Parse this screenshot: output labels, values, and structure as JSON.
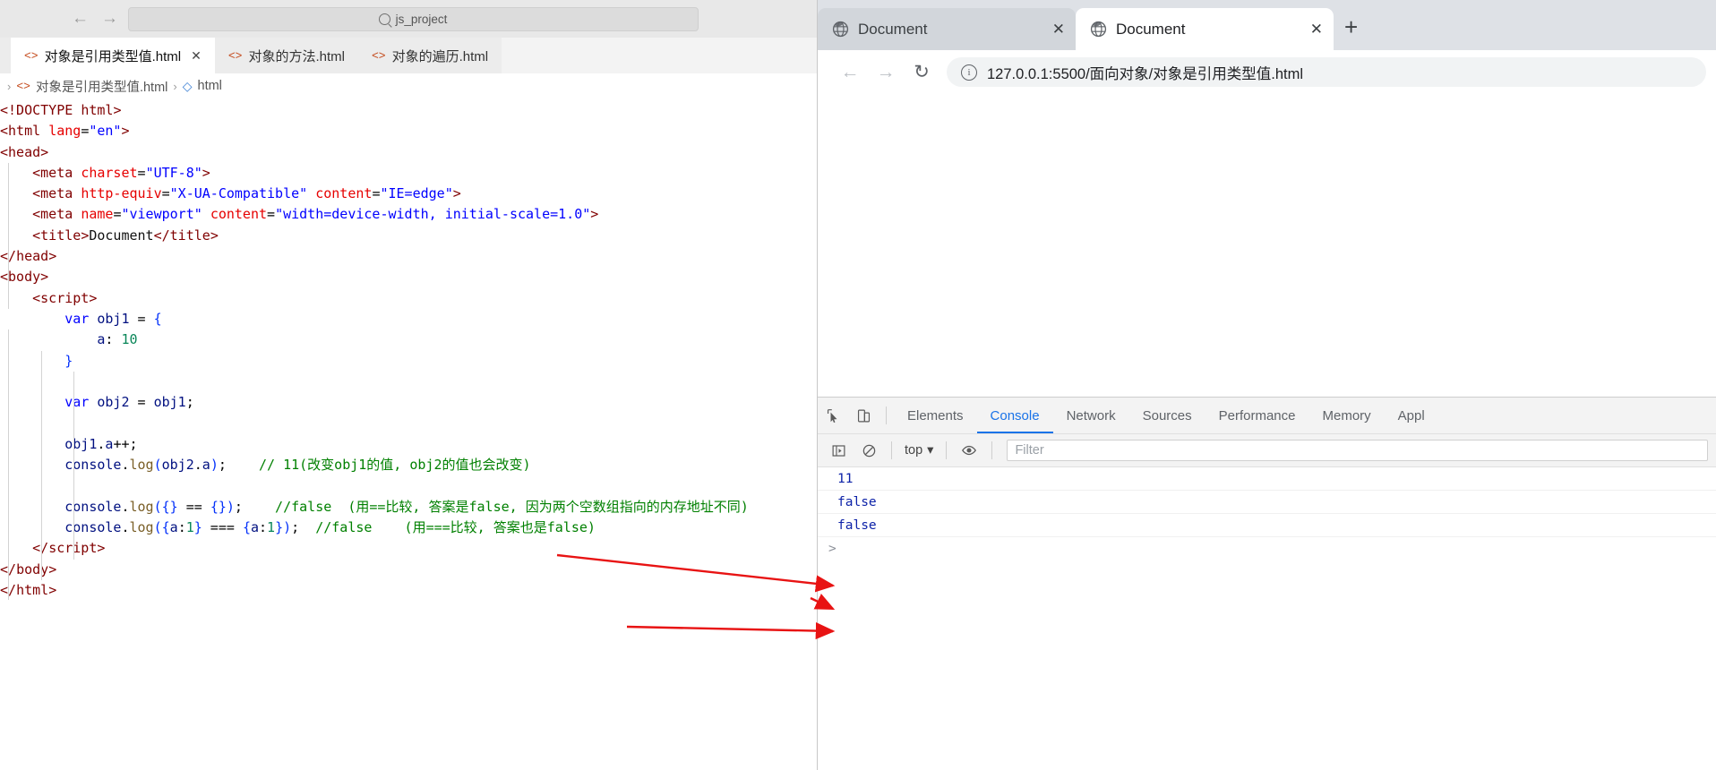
{
  "editor": {
    "quick_input_placeholder": "js_project",
    "nav_back_icon": "arrow-left-icon",
    "nav_forward_icon": "arrow-right-icon",
    "tabs": [
      {
        "label": "对象是引用类型值.html",
        "active": true,
        "close": "✕"
      },
      {
        "label": "对象的方法.html",
        "active": false,
        "close": ""
      },
      {
        "label": "对象的遍历.html",
        "active": false,
        "close": ""
      }
    ],
    "breadcrumb": {
      "lead_sep": "›",
      "file": "对象是引用类型值.html",
      "sep": "›",
      "symbol": "html"
    },
    "code_lines": [
      [
        [
          "tagbr",
          "<!DOCTYPE "
        ],
        [
          "tag",
          "html"
        ],
        [
          "tagbr",
          ">"
        ]
      ],
      [
        [
          "tagbr",
          "<"
        ],
        [
          "tag",
          "html"
        ],
        [
          "txt",
          " "
        ],
        [
          "attr",
          "lang"
        ],
        [
          "punct",
          "="
        ],
        [
          "val",
          "\"en\""
        ],
        [
          "tagbr",
          ">"
        ]
      ],
      [
        [
          "tagbr",
          "<"
        ],
        [
          "tag",
          "head"
        ],
        [
          "tagbr",
          ">"
        ]
      ],
      [
        [
          "txt",
          "    "
        ],
        [
          "tagbr",
          "<"
        ],
        [
          "tag",
          "meta"
        ],
        [
          "txt",
          " "
        ],
        [
          "attr",
          "charset"
        ],
        [
          "punct",
          "="
        ],
        [
          "val",
          "\"UTF-8\""
        ],
        [
          "tagbr",
          ">"
        ]
      ],
      [
        [
          "txt",
          "    "
        ],
        [
          "tagbr",
          "<"
        ],
        [
          "tag",
          "meta"
        ],
        [
          "txt",
          " "
        ],
        [
          "attr",
          "http-equiv"
        ],
        [
          "punct",
          "="
        ],
        [
          "val",
          "\"X-UA-Compatible\""
        ],
        [
          "txt",
          " "
        ],
        [
          "attr",
          "content"
        ],
        [
          "punct",
          "="
        ],
        [
          "val",
          "\"IE=edge\""
        ],
        [
          "tagbr",
          ">"
        ]
      ],
      [
        [
          "txt",
          "    "
        ],
        [
          "tagbr",
          "<"
        ],
        [
          "tag",
          "meta"
        ],
        [
          "txt",
          " "
        ],
        [
          "attr",
          "name"
        ],
        [
          "punct",
          "="
        ],
        [
          "val",
          "\"viewport\""
        ],
        [
          "txt",
          " "
        ],
        [
          "attr",
          "content"
        ],
        [
          "punct",
          "="
        ],
        [
          "val",
          "\"width=device-width, initial-scale=1.0\""
        ],
        [
          "tagbr",
          ">"
        ]
      ],
      [
        [
          "txt",
          "    "
        ],
        [
          "tagbr",
          "<"
        ],
        [
          "tag",
          "title"
        ],
        [
          "tagbr",
          ">"
        ],
        [
          "txt",
          "Document"
        ],
        [
          "tagbr",
          "</"
        ],
        [
          "tag",
          "title"
        ],
        [
          "tagbr",
          ">"
        ]
      ],
      [
        [
          "tagbr",
          "</"
        ],
        [
          "tag",
          "head"
        ],
        [
          "tagbr",
          ">"
        ]
      ],
      [
        [
          "tagbr",
          "<"
        ],
        [
          "tag",
          "body"
        ],
        [
          "tagbr",
          ">"
        ]
      ],
      [
        [
          "txt",
          "    "
        ],
        [
          "tagbr",
          "<"
        ],
        [
          "tag",
          "script"
        ],
        [
          "tagbr",
          ">"
        ]
      ],
      [
        [
          "txt",
          "        "
        ],
        [
          "kw",
          "var"
        ],
        [
          "txt",
          " "
        ],
        [
          "id",
          "obj1"
        ],
        [
          "punct",
          " = "
        ],
        [
          "brace-b",
          "{"
        ]
      ],
      [
        [
          "txt",
          "            "
        ],
        [
          "id",
          "a"
        ],
        [
          "punct",
          ": "
        ],
        [
          "num",
          "10"
        ]
      ],
      [
        [
          "txt",
          "        "
        ],
        [
          "brace-b",
          "}"
        ]
      ],
      [
        [
          "txt",
          ""
        ]
      ],
      [
        [
          "txt",
          "        "
        ],
        [
          "kw",
          "var"
        ],
        [
          "txt",
          " "
        ],
        [
          "id",
          "obj2"
        ],
        [
          "punct",
          " = "
        ],
        [
          "id",
          "obj1"
        ],
        [
          "punct",
          ";"
        ]
      ],
      [
        [
          "txt",
          ""
        ]
      ],
      [
        [
          "txt",
          "        "
        ],
        [
          "id",
          "obj1"
        ],
        [
          "punct",
          "."
        ],
        [
          "id",
          "a"
        ],
        [
          "punct",
          "++;"
        ]
      ],
      [
        [
          "txt",
          "        "
        ],
        [
          "id",
          "console"
        ],
        [
          "punct",
          "."
        ],
        [
          "fn",
          "log"
        ],
        [
          "brace-b",
          "("
        ],
        [
          "id",
          "obj2"
        ],
        [
          "punct",
          "."
        ],
        [
          "id",
          "a"
        ],
        [
          "brace-b",
          ")"
        ],
        [
          "punct",
          ";"
        ],
        [
          "cmt",
          "    // 11(改变obj1的值, obj2的值也会改变)"
        ]
      ],
      [
        [
          "txt",
          ""
        ]
      ],
      [
        [
          "txt",
          "        "
        ],
        [
          "id",
          "console"
        ],
        [
          "punct",
          "."
        ],
        [
          "fn",
          "log"
        ],
        [
          "brace-b",
          "("
        ],
        [
          "brace-b",
          "{}"
        ],
        [
          "punct",
          " == "
        ],
        [
          "brace-b",
          "{}"
        ],
        [
          "brace-b",
          ")"
        ],
        [
          "punct",
          ";"
        ],
        [
          "cmt",
          "    //false  (用==比较, 答案是false, 因为两个空数组指向的内存地址不同)"
        ]
      ],
      [
        [
          "txt",
          "        "
        ],
        [
          "id",
          "console"
        ],
        [
          "punct",
          "."
        ],
        [
          "fn",
          "log"
        ],
        [
          "brace-b",
          "("
        ],
        [
          "brace-b",
          "{"
        ],
        [
          "id",
          "a"
        ],
        [
          "punct",
          ":"
        ],
        [
          "num",
          "1"
        ],
        [
          "brace-b",
          "}"
        ],
        [
          "punct",
          " === "
        ],
        [
          "brace-b",
          "{"
        ],
        [
          "id",
          "a"
        ],
        [
          "punct",
          ":"
        ],
        [
          "num",
          "1"
        ],
        [
          "brace-b",
          "}"
        ],
        [
          "brace-b",
          ")"
        ],
        [
          "punct",
          ";"
        ],
        [
          "cmt",
          "  //false    (用===比较, 答案也是false)"
        ]
      ],
      [
        [
          "txt",
          "    "
        ],
        [
          "tagbr",
          "</"
        ],
        [
          "tag",
          "script"
        ],
        [
          "tagbr",
          ">"
        ]
      ],
      [
        [
          "tagbr",
          "</"
        ],
        [
          "tag",
          "body"
        ],
        [
          "tagbr",
          ">"
        ]
      ],
      [
        [
          "tagbr",
          "</"
        ],
        [
          "tag",
          "html"
        ],
        [
          "tagbr",
          ">"
        ]
      ]
    ]
  },
  "browser": {
    "tabs": [
      {
        "title": "Document",
        "active": false,
        "close": "✕"
      },
      {
        "title": "Document",
        "active": true,
        "close": "✕"
      }
    ],
    "new_tab_label": "+",
    "toolbar": {
      "back": "←",
      "forward": "→",
      "reload": "↻",
      "site_info_icon": "info-circle-icon",
      "url": "127.0.0.1:5500/面向对象/对象是引用类型值.html"
    }
  },
  "devtools": {
    "inspect_icon": "cursor-select-icon",
    "device_icon": "device-toolbar-icon",
    "tabs": [
      {
        "label": "Elements",
        "active": false
      },
      {
        "label": "Console",
        "active": true
      },
      {
        "label": "Network",
        "active": false
      },
      {
        "label": "Sources",
        "active": false
      },
      {
        "label": "Performance",
        "active": false
      },
      {
        "label": "Memory",
        "active": false
      },
      {
        "label": "Appl",
        "active": false
      }
    ],
    "console_toolbar": {
      "execute_icon": "console-sidebar-icon",
      "clear_icon": "clear-console-icon",
      "context": "top",
      "context_caret": "▾",
      "eye_icon": "live-expression-icon",
      "filter_placeholder": "Filter"
    },
    "console_output": [
      "11",
      "false",
      "false"
    ],
    "prompt": ">"
  },
  "colors": {
    "accent": "#1a73e8",
    "arrow": "#e81313",
    "comment": "#008000",
    "console_value": "#0d22a8"
  }
}
